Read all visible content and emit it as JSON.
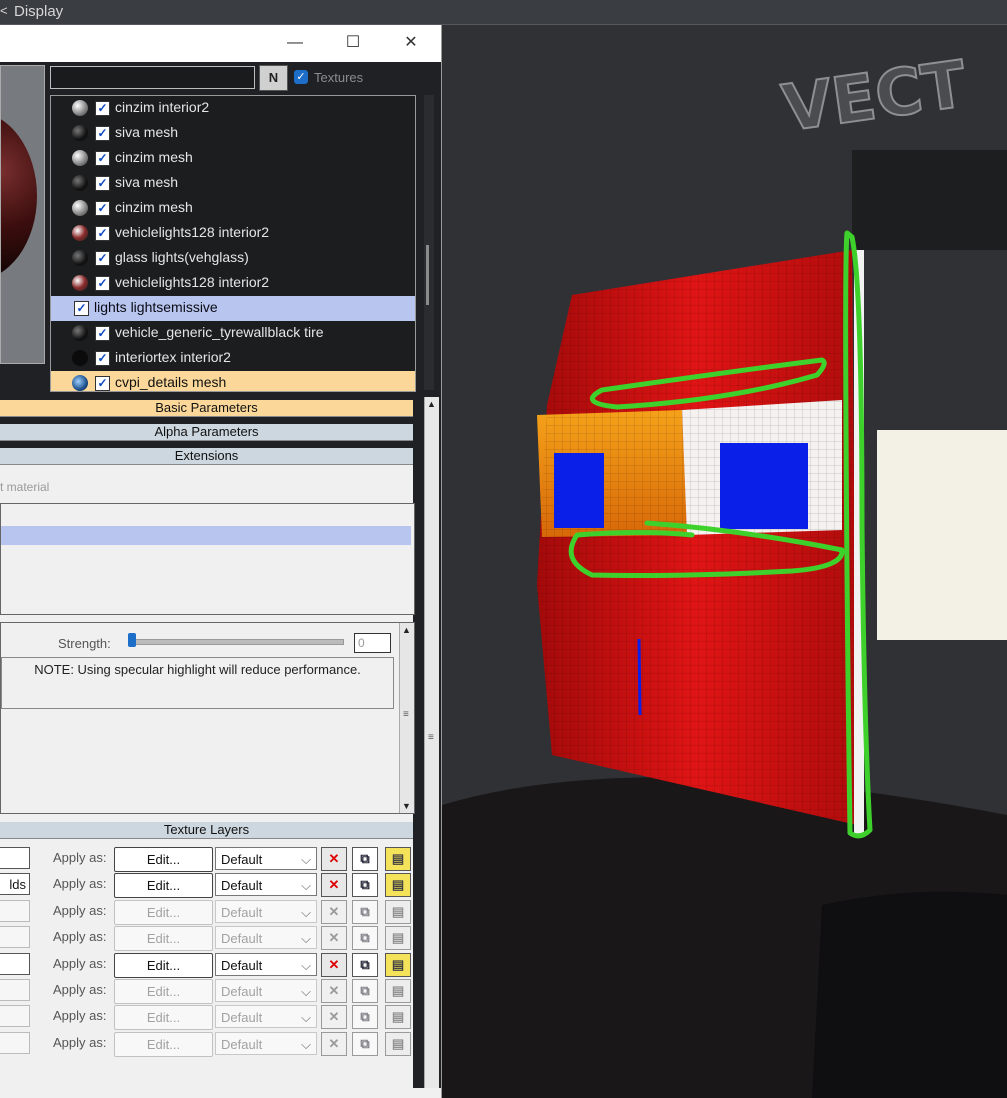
{
  "app": {
    "top_title": "Display",
    "top_arrow": "<"
  },
  "window": {
    "minimize": "—",
    "maximize": "☐",
    "close": "✕"
  },
  "search": {
    "value": "",
    "button_glyph": "N",
    "textures_label": "Textures",
    "textures_checked": true
  },
  "materials": [
    {
      "label": "cinzim interior2",
      "ball": "gray"
    },
    {
      "label": "siva mesh",
      "ball": "dark"
    },
    {
      "label": "cinzim mesh",
      "ball": "gray"
    },
    {
      "label": "siva mesh",
      "ball": "dark"
    },
    {
      "label": "cinzim mesh",
      "ball": "gray"
    },
    {
      "label": "vehiclelights128 interior2",
      "ball": "red"
    },
    {
      "label": "glass lights(vehglass)",
      "ball": "dark"
    },
    {
      "label": "vehiclelights128 interior2",
      "ball": "red"
    },
    {
      "label": "lights lightsemissive",
      "ball": "none",
      "state": "selected"
    },
    {
      "label": "vehicle_generic_tyrewallblack tire",
      "ball": "dark"
    },
    {
      "label": "interiortex interior2",
      "ball": "black"
    },
    {
      "label": "cvpi_details mesh",
      "ball": "blue",
      "state": "highlight"
    }
  ],
  "rollouts": {
    "basic": "Basic Parameters",
    "alpha": "Alpha Parameters",
    "extensions": "Extensions",
    "texture_layers": "Texture Layers"
  },
  "extensions": {
    "label_partial": "t material"
  },
  "specular": {
    "strength_label": "Strength:",
    "strength_value": "0",
    "note": "NOTE: Using specular highlight will reduce performance."
  },
  "texture_layers": [
    {
      "input": "",
      "apply": "Apply as:",
      "edit": "Edit...",
      "mode": "Default",
      "enabled": true
    },
    {
      "input": "lds",
      "apply": "Apply as:",
      "edit": "Edit...",
      "mode": "Default",
      "enabled": true
    },
    {
      "input": "",
      "apply": "Apply as:",
      "edit": "Edit...",
      "mode": "Default",
      "enabled": false
    },
    {
      "input": "",
      "apply": "Apply as:",
      "edit": "Edit...",
      "mode": "Default",
      "enabled": false
    },
    {
      "input": "",
      "apply": "Apply as:",
      "edit": "Edit...",
      "mode": "Default",
      "enabled": true
    },
    {
      "input": "",
      "apply": "Apply as:",
      "edit": "Edit...",
      "mode": "Default",
      "enabled": false
    },
    {
      "input": "",
      "apply": "Apply as:",
      "edit": "Edit...",
      "mode": "Default",
      "enabled": false
    },
    {
      "input": "",
      "apply": "Apply as:",
      "edit": "Edit...",
      "mode": "Default",
      "enabled": false
    }
  ],
  "viewport": {
    "sign_text": "VECT"
  },
  "colors": {
    "selected_row": "#b8c5ee",
    "highlight_row": "#fbd89a",
    "annotation_green": "#3fd12b",
    "marker_blue": "#0a1fe8"
  }
}
